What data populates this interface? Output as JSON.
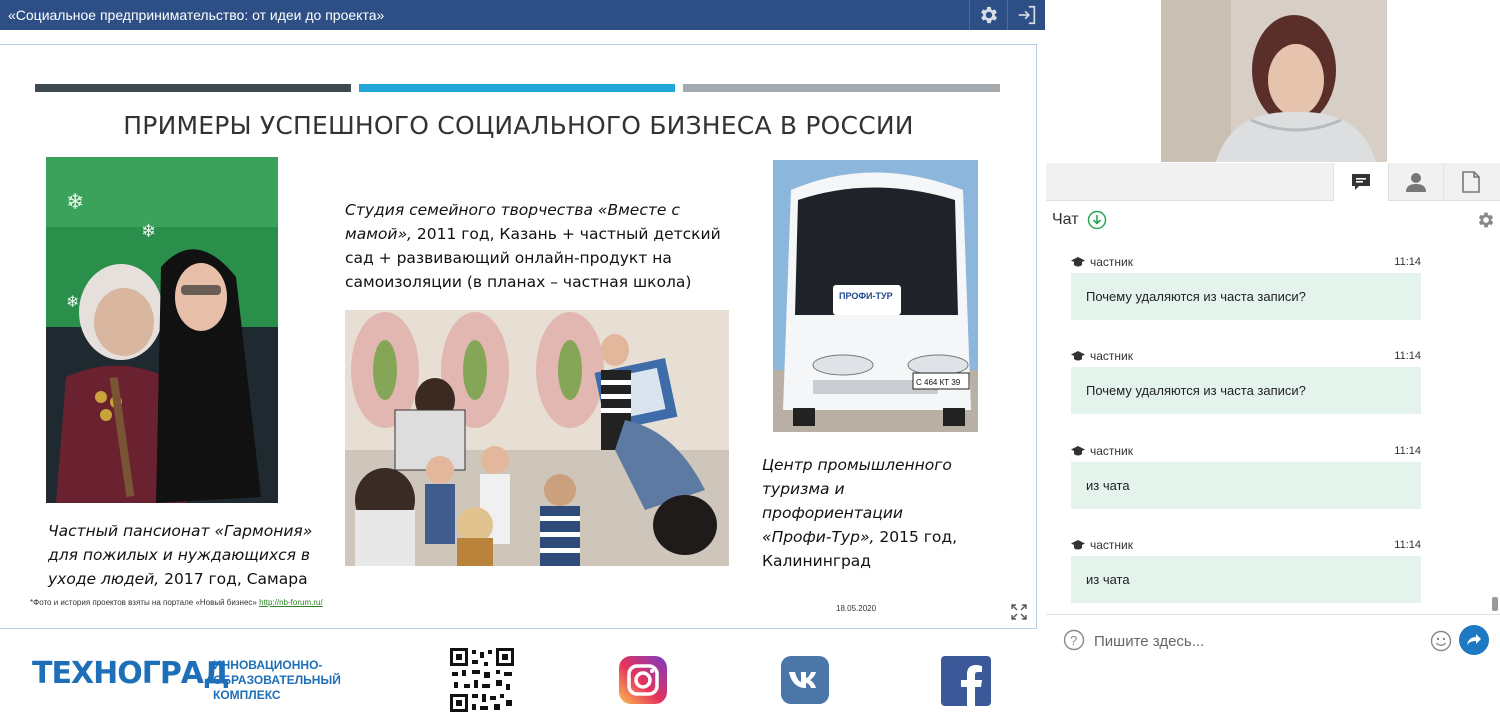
{
  "header": {
    "title": "«Социальное предпринимательство: от идеи до проекта»"
  },
  "slide": {
    "title": "ПРИМЕРЫ УСПЕШНОГО СОЦИАЛЬНОГО БИЗНЕСА В РОССИИ",
    "bar_colors": [
      "#3d4a50",
      "#23a6db",
      "#a4a9ae"
    ],
    "caption1": {
      "line1": "Частный пансионат «Гармония»",
      "line2": "для пожилых и нуждающихся в",
      "line3_italic": "уходе людей,",
      "line3_plain": " 2017 год, Самара"
    },
    "caption2": {
      "line1": "Студия семейного творчества «Вместе с",
      "line2_italic": "мамой»,",
      "line2_plain": " 2011 год, Казань + частный детский",
      "line3": "сад + развивающий онлайн-продукт на",
      "line4": "самоизоляции (в планах – частная школа)"
    },
    "caption3": {
      "line1": "Центр промышленного",
      "line2": "туризма и",
      "line3": "профориентации",
      "line4_italic": "«Профи-Тур»,",
      "line4_plain": " 2015 год,",
      "line5": "Калининград"
    },
    "bus_sign": "ПРОФИ-ТУР",
    "bus_plate": "С 464 КТ 39",
    "footnote_text": "*Фото и история проектов взяты на портале «Новый бизнес» ",
    "footnote_link": "http://nb-forum.ru/",
    "date": "18.05.2020"
  },
  "footer": {
    "brand": "ТЕХНОГРАД",
    "desc_line1": "ИННОВАЦИОННО-",
    "desc_line2": "ОБРАЗОВАТЕЛЬНЫЙ",
    "desc_line3": "КОМПЛЕКС"
  },
  "chat": {
    "title": "Чат",
    "messages": [
      {
        "author": "частник",
        "time": "11:14",
        "text": "Почему удаляются из часта записи?"
      },
      {
        "author": "частник",
        "time": "11:14",
        "text": "Почему удаляются из часта записи?"
      },
      {
        "author": "частник",
        "time": "11:14",
        "text": "из чата"
      },
      {
        "author": "частник",
        "time": "11:14",
        "text": "из чата"
      }
    ],
    "input_placeholder": "Пишите здесь..."
  },
  "icons": {
    "settings": "gear-icon",
    "exit": "exit-icon",
    "chat_tab": "chat-bubble-icon",
    "users_tab": "user-icon",
    "files_tab": "document-icon",
    "download": "download-icon",
    "help": "question-icon",
    "emoji": "smiley-icon",
    "send": "send-arrow-icon",
    "expand": "expand-icon",
    "author": "graduation-cap-icon"
  },
  "colors": {
    "header_bg": "#2d4f86",
    "chat_bubble": "#e4f4ec",
    "brand_blue": "#1d6fb8",
    "send_button": "#1d79c3"
  }
}
